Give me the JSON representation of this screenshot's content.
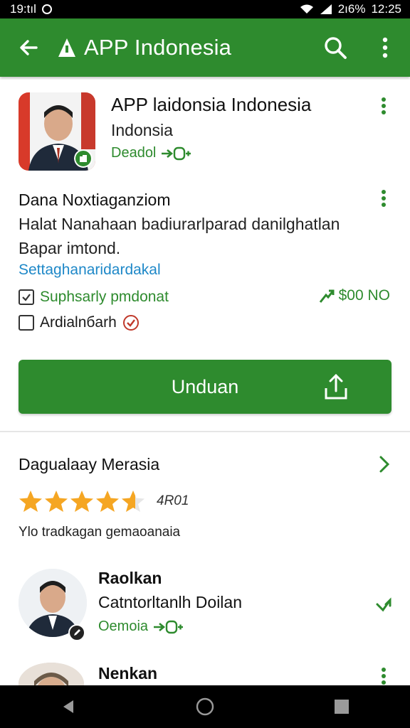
{
  "status_bar": {
    "left_text": "19:tıl",
    "battery": "2ı6%",
    "time": "12:25"
  },
  "app_bar": {
    "title": "APP Indonesia"
  },
  "app_card": {
    "name": "APP laidonsia Indonesia",
    "subtitle": "Indonsia",
    "developer": "Deadol",
    "section_title": "Dana Noxtiaganziom",
    "description": "Halat Nanahaan badiurarlparad danilghatlan Bapar imtond.",
    "link": "Settaghanaridardakal",
    "checkbox_1": "Suphsarly pmdonat",
    "checkbox_2": "Ardialnбarh",
    "price": "$00 NO",
    "download_button": "Unduan"
  },
  "ratings_card": {
    "title": "Dagualaay Merasia",
    "rating_value": 4.5,
    "rating_count": "4R01",
    "note": "Ylo tradkagan gemaoanaia",
    "reviewer_1": {
      "name": "Raolkan",
      "line": "Catntorltanlh Doilan",
      "tag": "Oemoia"
    },
    "reviewer_2": {
      "name": "Nenkan"
    }
  },
  "colors": {
    "brand_green": "#2e8b2e",
    "star": "#f5a623",
    "link": "#1e88c8"
  }
}
